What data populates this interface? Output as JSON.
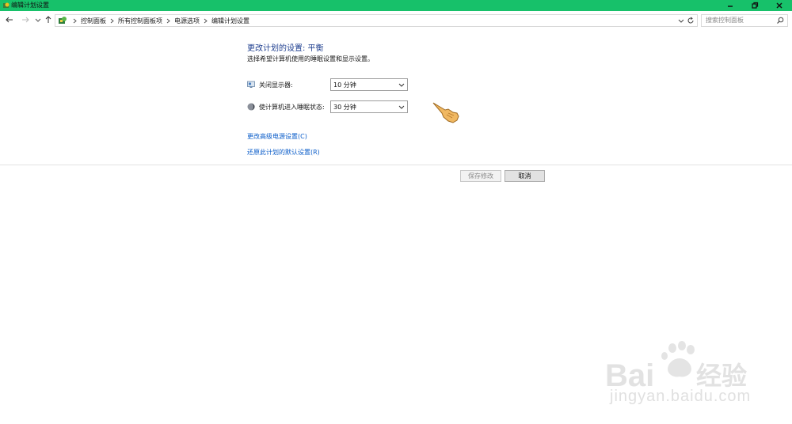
{
  "window": {
    "title": "编辑计划设置",
    "controls": [
      "minimize",
      "restore",
      "close"
    ],
    "accent": "#17c16a"
  },
  "address_bar": {
    "breadcrumbs": [
      "控制面板",
      "所有控制面板项",
      "电源选项",
      "编辑计划设置"
    ],
    "search_placeholder": "搜索控制面板"
  },
  "main": {
    "heading": "更改计划的设置: 平衡",
    "subheading": "选择希望计算机使用的睡眠设置和显示设置。",
    "settings": [
      {
        "label": "关闭显示器:",
        "value": "10 分钟",
        "icon": "monitor-icon"
      },
      {
        "label": "使计算机进入睡眠状态:",
        "value": "30 分钟",
        "icon": "moon-icon"
      }
    ],
    "links": [
      {
        "label": "更改高级电源设置(C)"
      },
      {
        "label": "还原此计划的默认设置(R)"
      }
    ],
    "buttons": {
      "save": "保存修改",
      "cancel": "取消"
    }
  },
  "watermark": {
    "brand": "Bai du 经验",
    "site": "jingyan.baidu.com"
  }
}
